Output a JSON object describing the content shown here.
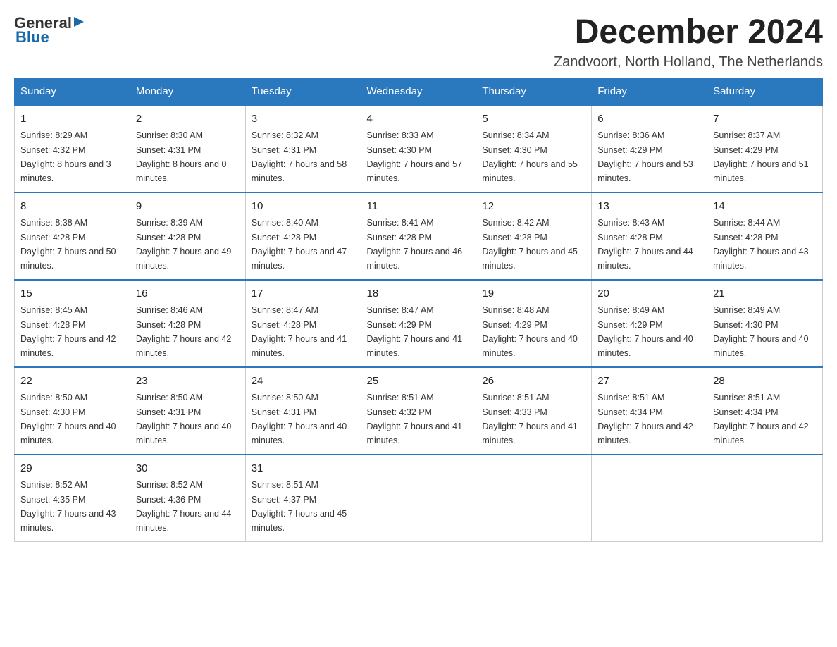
{
  "header": {
    "logo_general": "General",
    "logo_blue": "Blue",
    "month_title": "December 2024",
    "location": "Zandvoort, North Holland, The Netherlands"
  },
  "weekdays": [
    "Sunday",
    "Monday",
    "Tuesday",
    "Wednesday",
    "Thursday",
    "Friday",
    "Saturday"
  ],
  "weeks": [
    [
      {
        "day": "1",
        "sunrise": "8:29 AM",
        "sunset": "4:32 PM",
        "daylight": "8 hours and 3 minutes."
      },
      {
        "day": "2",
        "sunrise": "8:30 AM",
        "sunset": "4:31 PM",
        "daylight": "8 hours and 0 minutes."
      },
      {
        "day": "3",
        "sunrise": "8:32 AM",
        "sunset": "4:31 PM",
        "daylight": "7 hours and 58 minutes."
      },
      {
        "day": "4",
        "sunrise": "8:33 AM",
        "sunset": "4:30 PM",
        "daylight": "7 hours and 57 minutes."
      },
      {
        "day": "5",
        "sunrise": "8:34 AM",
        "sunset": "4:30 PM",
        "daylight": "7 hours and 55 minutes."
      },
      {
        "day": "6",
        "sunrise": "8:36 AM",
        "sunset": "4:29 PM",
        "daylight": "7 hours and 53 minutes."
      },
      {
        "day": "7",
        "sunrise": "8:37 AM",
        "sunset": "4:29 PM",
        "daylight": "7 hours and 51 minutes."
      }
    ],
    [
      {
        "day": "8",
        "sunrise": "8:38 AM",
        "sunset": "4:28 PM",
        "daylight": "7 hours and 50 minutes."
      },
      {
        "day": "9",
        "sunrise": "8:39 AM",
        "sunset": "4:28 PM",
        "daylight": "7 hours and 49 minutes."
      },
      {
        "day": "10",
        "sunrise": "8:40 AM",
        "sunset": "4:28 PM",
        "daylight": "7 hours and 47 minutes."
      },
      {
        "day": "11",
        "sunrise": "8:41 AM",
        "sunset": "4:28 PM",
        "daylight": "7 hours and 46 minutes."
      },
      {
        "day": "12",
        "sunrise": "8:42 AM",
        "sunset": "4:28 PM",
        "daylight": "7 hours and 45 minutes."
      },
      {
        "day": "13",
        "sunrise": "8:43 AM",
        "sunset": "4:28 PM",
        "daylight": "7 hours and 44 minutes."
      },
      {
        "day": "14",
        "sunrise": "8:44 AM",
        "sunset": "4:28 PM",
        "daylight": "7 hours and 43 minutes."
      }
    ],
    [
      {
        "day": "15",
        "sunrise": "8:45 AM",
        "sunset": "4:28 PM",
        "daylight": "7 hours and 42 minutes."
      },
      {
        "day": "16",
        "sunrise": "8:46 AM",
        "sunset": "4:28 PM",
        "daylight": "7 hours and 42 minutes."
      },
      {
        "day": "17",
        "sunrise": "8:47 AM",
        "sunset": "4:28 PM",
        "daylight": "7 hours and 41 minutes."
      },
      {
        "day": "18",
        "sunrise": "8:47 AM",
        "sunset": "4:29 PM",
        "daylight": "7 hours and 41 minutes."
      },
      {
        "day": "19",
        "sunrise": "8:48 AM",
        "sunset": "4:29 PM",
        "daylight": "7 hours and 40 minutes."
      },
      {
        "day": "20",
        "sunrise": "8:49 AM",
        "sunset": "4:29 PM",
        "daylight": "7 hours and 40 minutes."
      },
      {
        "day": "21",
        "sunrise": "8:49 AM",
        "sunset": "4:30 PM",
        "daylight": "7 hours and 40 minutes."
      }
    ],
    [
      {
        "day": "22",
        "sunrise": "8:50 AM",
        "sunset": "4:30 PM",
        "daylight": "7 hours and 40 minutes."
      },
      {
        "day": "23",
        "sunrise": "8:50 AM",
        "sunset": "4:31 PM",
        "daylight": "7 hours and 40 minutes."
      },
      {
        "day": "24",
        "sunrise": "8:50 AM",
        "sunset": "4:31 PM",
        "daylight": "7 hours and 40 minutes."
      },
      {
        "day": "25",
        "sunrise": "8:51 AM",
        "sunset": "4:32 PM",
        "daylight": "7 hours and 41 minutes."
      },
      {
        "day": "26",
        "sunrise": "8:51 AM",
        "sunset": "4:33 PM",
        "daylight": "7 hours and 41 minutes."
      },
      {
        "day": "27",
        "sunrise": "8:51 AM",
        "sunset": "4:34 PM",
        "daylight": "7 hours and 42 minutes."
      },
      {
        "day": "28",
        "sunrise": "8:51 AM",
        "sunset": "4:34 PM",
        "daylight": "7 hours and 42 minutes."
      }
    ],
    [
      {
        "day": "29",
        "sunrise": "8:52 AM",
        "sunset": "4:35 PM",
        "daylight": "7 hours and 43 minutes."
      },
      {
        "day": "30",
        "sunrise": "8:52 AM",
        "sunset": "4:36 PM",
        "daylight": "7 hours and 44 minutes."
      },
      {
        "day": "31",
        "sunrise": "8:51 AM",
        "sunset": "4:37 PM",
        "daylight": "7 hours and 45 minutes."
      },
      null,
      null,
      null,
      null
    ]
  ],
  "labels": {
    "sunrise": "Sunrise:",
    "sunset": "Sunset:",
    "daylight": "Daylight:"
  }
}
